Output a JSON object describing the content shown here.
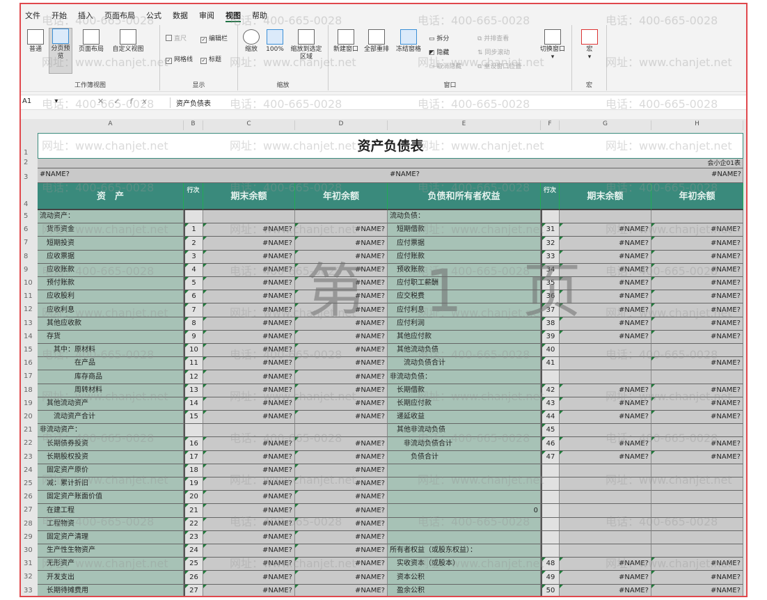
{
  "ribbon": {
    "tabs": [
      "文件",
      "开始",
      "插入",
      "页面布局",
      "公式",
      "数据",
      "审阅",
      "视图",
      "帮助"
    ],
    "active_tab": "视图",
    "workbook_views": {
      "label": "工作簿视图",
      "normal": "普通",
      "page_break": "分页预览",
      "page_layout": "页面布局",
      "custom": "自定义视图"
    },
    "show": {
      "label": "显示",
      "ruler": "直尺",
      "formula_bar": "编辑栏",
      "gridlines": "网格线",
      "headings": "标题"
    },
    "zoom": {
      "label": "缩放",
      "zoom": "缩放",
      "hundred": "100%",
      "to_selection": "缩放到选定区域"
    },
    "window": {
      "label": "窗口",
      "new": "新建窗口",
      "arrange": "全部重排",
      "freeze": "冻结窗格",
      "split": "拆分",
      "hide": "隐藏",
      "unhide": "取消隐藏",
      "side": "并排查看",
      "sync": "同步滚动",
      "reset": "重设窗口位置",
      "switch": "切换窗口"
    },
    "macros": {
      "label": "宏",
      "macro": "宏"
    }
  },
  "formula_bar": {
    "name_box": "A1",
    "fx": "fx",
    "value": "资产负债表"
  },
  "columns": [
    "A",
    "B",
    "C",
    "D",
    "E",
    "F",
    "G",
    "H"
  ],
  "sheet": {
    "title": "资产负债表",
    "form_no": "会小企01表",
    "row3": {
      "a": "#NAME?",
      "e": "#NAME?",
      "h": "#NAME?"
    },
    "headers": [
      "资　产",
      "行次",
      "期末余额",
      "年初余额",
      "负债和所有者权益",
      "行次",
      "期末余额",
      "年初余额"
    ],
    "rows": [
      [
        "流动资产：",
        "",
        "",
        "",
        "流动负债：",
        "",
        "",
        ""
      ],
      [
        "　货币资金",
        "1",
        "#NAME?",
        "#NAME?",
        "　短期借款",
        "31",
        "#NAME?",
        "#NAME?"
      ],
      [
        "　短期投资",
        "2",
        "#NAME?",
        "#NAME?",
        "　应付票据",
        "32",
        "#NAME?",
        "#NAME?"
      ],
      [
        "　应收票据",
        "3",
        "#NAME?",
        "#NAME?",
        "　应付账款",
        "33",
        "#NAME?",
        "#NAME?"
      ],
      [
        "　应收账款",
        "4",
        "#NAME?",
        "#NAME?",
        "　预收账款",
        "34",
        "#NAME?",
        "#NAME?"
      ],
      [
        "　预付账款",
        "5",
        "#NAME?",
        "#NAME?",
        "　应付职工薪酬",
        "35",
        "#NAME?",
        "#NAME?"
      ],
      [
        "　应收股利",
        "6",
        "#NAME?",
        "#NAME?",
        "　应交税费",
        "36",
        "#NAME?",
        "#NAME?"
      ],
      [
        "　应收利息",
        "7",
        "#NAME?",
        "#NAME?",
        "　应付利息",
        "37",
        "#NAME?",
        "#NAME?"
      ],
      [
        "　其他应收款",
        "8",
        "#NAME?",
        "#NAME?",
        "　应付利润",
        "38",
        "#NAME?",
        "#NAME?"
      ],
      [
        "　存货",
        "9",
        "#NAME?",
        "#NAME?",
        "　其他应付款",
        "39",
        "#NAME?",
        "#NAME?"
      ],
      [
        "　　其中：原材料",
        "10",
        "#NAME?",
        "#NAME?",
        "　其他流动负债",
        "40",
        "",
        ""
      ],
      [
        "　　　　　在产品",
        "11",
        "#NAME?",
        "#NAME?",
        "　　流动负债合计",
        "41",
        "",
        "#NAME?"
      ],
      [
        "　　　　　库存商品",
        "12",
        "#NAME?",
        "#NAME?",
        "非流动负债：",
        "",
        "",
        ""
      ],
      [
        "　　　　　周转材料",
        "13",
        "#NAME?",
        "#NAME?",
        "　长期借款",
        "42",
        "#NAME?",
        "#NAME?"
      ],
      [
        "　其他流动资产",
        "14",
        "#NAME?",
        "#NAME?",
        "　长期应付款",
        "43",
        "#NAME?",
        "#NAME?"
      ],
      [
        "　　流动资产合计",
        "15",
        "#NAME?",
        "#NAME?",
        "　递延收益",
        "44",
        "#NAME?",
        "#NAME?"
      ],
      [
        "非流动资产：",
        "",
        "",
        "",
        "　其他非流动负债",
        "45",
        "",
        ""
      ],
      [
        "　长期债券投资",
        "16",
        "#NAME?",
        "#NAME?",
        "　　非流动负债合计",
        "46",
        "#NAME?",
        "#NAME?"
      ],
      [
        "　长期股权投资",
        "17",
        "#NAME?",
        "#NAME?",
        "　　　负债合计",
        "47",
        "#NAME?",
        "#NAME?"
      ],
      [
        "　固定资产原价",
        "18",
        "#NAME?",
        "#NAME?",
        "",
        "",
        "",
        ""
      ],
      [
        "　减：累计折旧",
        "19",
        "#NAME?",
        "#NAME?",
        "",
        "",
        "",
        ""
      ],
      [
        "　固定资产账面价值",
        "20",
        "#NAME?",
        "#NAME?",
        "",
        "",
        "",
        ""
      ],
      [
        "　在建工程",
        "21",
        "#NAME?",
        "#NAME?",
        "0",
        "",
        "",
        ""
      ],
      [
        "　工程物资",
        "22",
        "#NAME?",
        "#NAME?",
        "",
        "",
        "",
        ""
      ],
      [
        "　固定资产清理",
        "23",
        "#NAME?",
        "#NAME?",
        "",
        "",
        "",
        ""
      ],
      [
        "　生产性生物资产",
        "24",
        "#NAME?",
        "#NAME?",
        "所有者权益（或股东权益）：",
        "",
        "",
        ""
      ],
      [
        "　无形资产",
        "25",
        "#NAME?",
        "#NAME?",
        "　实收资本（或股本）",
        "48",
        "#NAME?",
        "#NAME?"
      ],
      [
        "　开发支出",
        "26",
        "#NAME?",
        "#NAME?",
        "　资本公积",
        "49",
        "#NAME?",
        "#NAME?"
      ],
      [
        "　长期待摊费用",
        "27",
        "#NAME?",
        "#NAME?",
        "　盈余公积",
        "50",
        "#NAME?",
        "#NAME?"
      ]
    ]
  },
  "watermarks": {
    "phone": "电话：400-665-0028",
    "site": "网址：www.chanjet.net",
    "page_label": "第 1 页"
  },
  "colors": {
    "header": "#3a8a7c",
    "label_cell": "#a7c2b6",
    "value_cell": "#c9c9c9",
    "frame": "#e0474c"
  }
}
